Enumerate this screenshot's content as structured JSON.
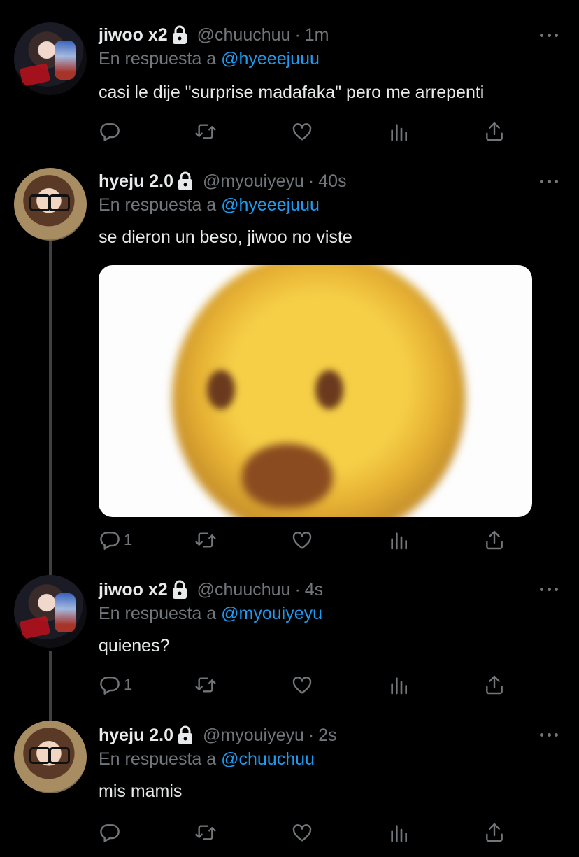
{
  "tweets": [
    {
      "name": "jiwoo x2",
      "handle": "@chuuchuu",
      "time": "1m",
      "reply_prefix": "En respuesta a",
      "reply_to": "@hyeeejuuu",
      "text": "casi le dije \"surprise madafaka\" pero me arrepenti",
      "reply_count": ""
    },
    {
      "name": "hyeju 2.0",
      "handle": "@myouiyeyu",
      "time": "40s",
      "reply_prefix": "En respuesta a",
      "reply_to": "@hyeeejuuu",
      "text": "se dieron un beso, jiwoo no viste",
      "reply_count": "1"
    },
    {
      "name": "jiwoo x2",
      "handle": "@chuuchuu",
      "time": "4s",
      "reply_prefix": "En respuesta a",
      "reply_to": "@myouiyeyu",
      "text": "quienes?",
      "reply_count": "1"
    },
    {
      "name": "hyeju 2.0",
      "handle": "@myouiyeyu",
      "time": "2s",
      "reply_prefix": "En respuesta a",
      "reply_to": "@chuuchuu",
      "text": "mis mamis",
      "reply_count": ""
    }
  ],
  "separator": "·",
  "icons": {
    "reply": "reply-icon",
    "retweet": "retweet-icon",
    "like": "heart-icon",
    "views": "analytics-icon",
    "share": "share-icon",
    "more": "more-icon",
    "lock": "lock-icon"
  },
  "colors": {
    "background": "#000000",
    "text": "#e7e9ea",
    "secondary": "#71767b",
    "accent": "#1d9bf0",
    "divider": "#2f3336"
  }
}
